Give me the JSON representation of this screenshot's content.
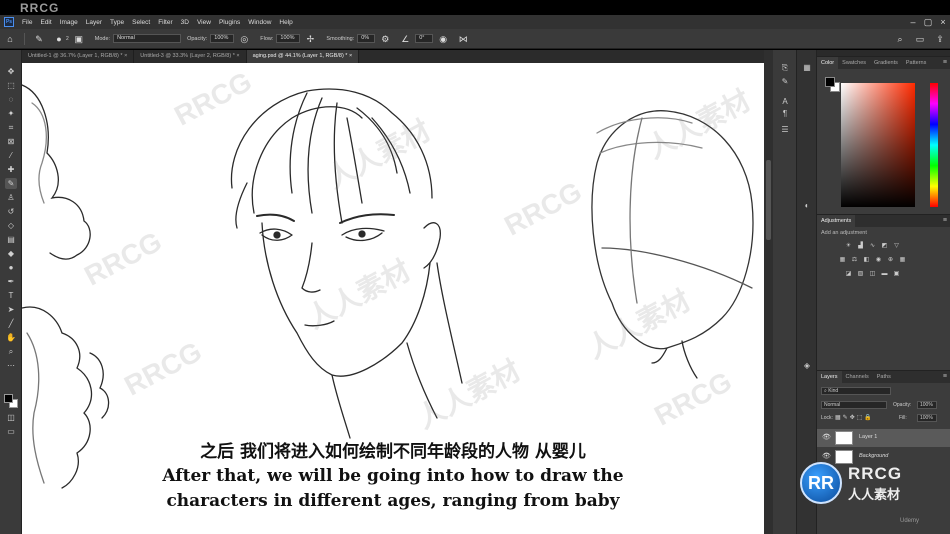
{
  "watermark_top": "RRCG",
  "app": {
    "logo": "Ps",
    "menu": [
      "File",
      "Edit",
      "Image",
      "Layer",
      "Type",
      "Select",
      "Filter",
      "3D",
      "View",
      "Plugins",
      "Window",
      "Help"
    ]
  },
  "options": {
    "brush_size": "2",
    "mode_label": "Mode:",
    "mode_value": "Normal",
    "opacity_label": "Opacity:",
    "opacity_value": "100%",
    "flow_label": "Flow:",
    "flow_value": "100%",
    "smoothing_label": "Smoothing:",
    "smoothing_value": "0%",
    "angle_value": "0°"
  },
  "tabs": [
    {
      "label": "Untitled-1 @ 36.7% (Layer 1, RGB/8) *",
      "close": "×"
    },
    {
      "label": "Untitled-3 @ 33.3% (Layer 2, RGB/8) *",
      "close": "×"
    },
    {
      "label": "aging.psd @ 44.1% (Layer 1, RGB/8) *",
      "close": "×"
    }
  ],
  "subtitles": {
    "cn": "之后 我们将进入如何绘制不同年龄段的人物 从婴儿",
    "en_line1": "After that, we will be going into how to draw the",
    "en_line2": "characters in different ages, ranging from baby"
  },
  "canvas_watermarks": [
    "RRCG",
    "人人素材",
    "RRCG",
    "人人素材",
    "RRCG",
    "人人素材",
    "RRCG",
    "人人素材",
    "RRCG",
    "人人素材"
  ],
  "color_panel": {
    "tabs": [
      "Color",
      "Swatches",
      "Gradients",
      "Patterns"
    ],
    "foreground": "#000000",
    "background": "#ffffff"
  },
  "adjustments_panel": {
    "title": "Adjustments",
    "add_label": "Add an adjustment"
  },
  "layers_panel": {
    "tabs": [
      "Layers",
      "Channels",
      "Paths"
    ],
    "kind_label": "Kind",
    "blend_mode": "Normal",
    "opacity_label": "Opacity:",
    "opacity_value": "100%",
    "lock_label": "Lock:",
    "fill_label": "Fill:",
    "fill_value": "100%",
    "layers": [
      {
        "name": "Layer 1",
        "selected": true
      },
      {
        "name": "Background",
        "selected": false
      }
    ]
  },
  "branding": {
    "logo_mark": "RR",
    "name_en": "RRCG",
    "name_cn": "人人素材",
    "udemy": "Udemy"
  }
}
